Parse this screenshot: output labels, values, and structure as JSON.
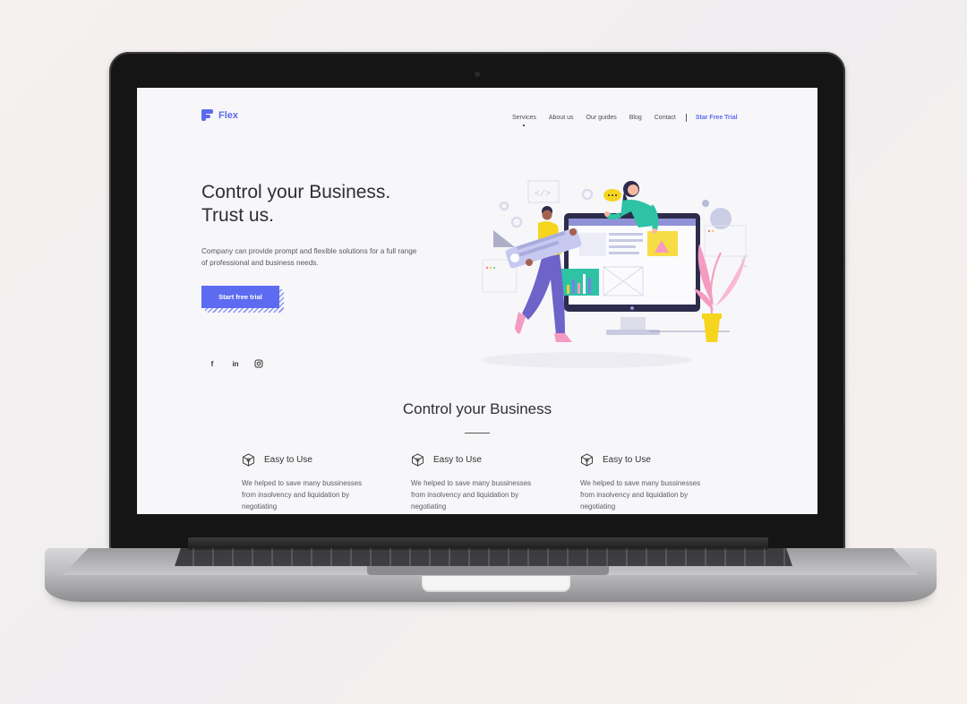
{
  "brand": {
    "name": "Flex",
    "accent": "#5c6bf0"
  },
  "nav": {
    "items": [
      "Services",
      "About us",
      "Our guides",
      "Blog",
      "Contact"
    ],
    "active": "Services",
    "cta": "Star Free Trial"
  },
  "hero": {
    "title_line1": "Control your Business.",
    "title_line2": "Trust us.",
    "description": "Company can provide prompt and flexible solutions for a full range of professional and business needs.",
    "cta": "Start free trial"
  },
  "socials": [
    {
      "name": "facebook-icon",
      "glyph": "f"
    },
    {
      "name": "linkedin-icon",
      "glyph": "in"
    },
    {
      "name": "instagram-icon",
      "glyph": "◎"
    }
  ],
  "section": {
    "title": "Control your Business",
    "features": [
      {
        "icon": "cube-icon",
        "title": "Easy to Use",
        "text": "We helped to save many bussinesses from insolvency and liquidation by negotiating"
      },
      {
        "icon": "cube-icon",
        "title": "Easy to Use",
        "text": "We helped to save many bussinesses from insolvency and liquidation by negotiating"
      },
      {
        "icon": "cube-icon",
        "title": "Easy to Use",
        "text": "We helped to save many bussinesses from insolvency and liquidation by negotiating"
      }
    ]
  }
}
